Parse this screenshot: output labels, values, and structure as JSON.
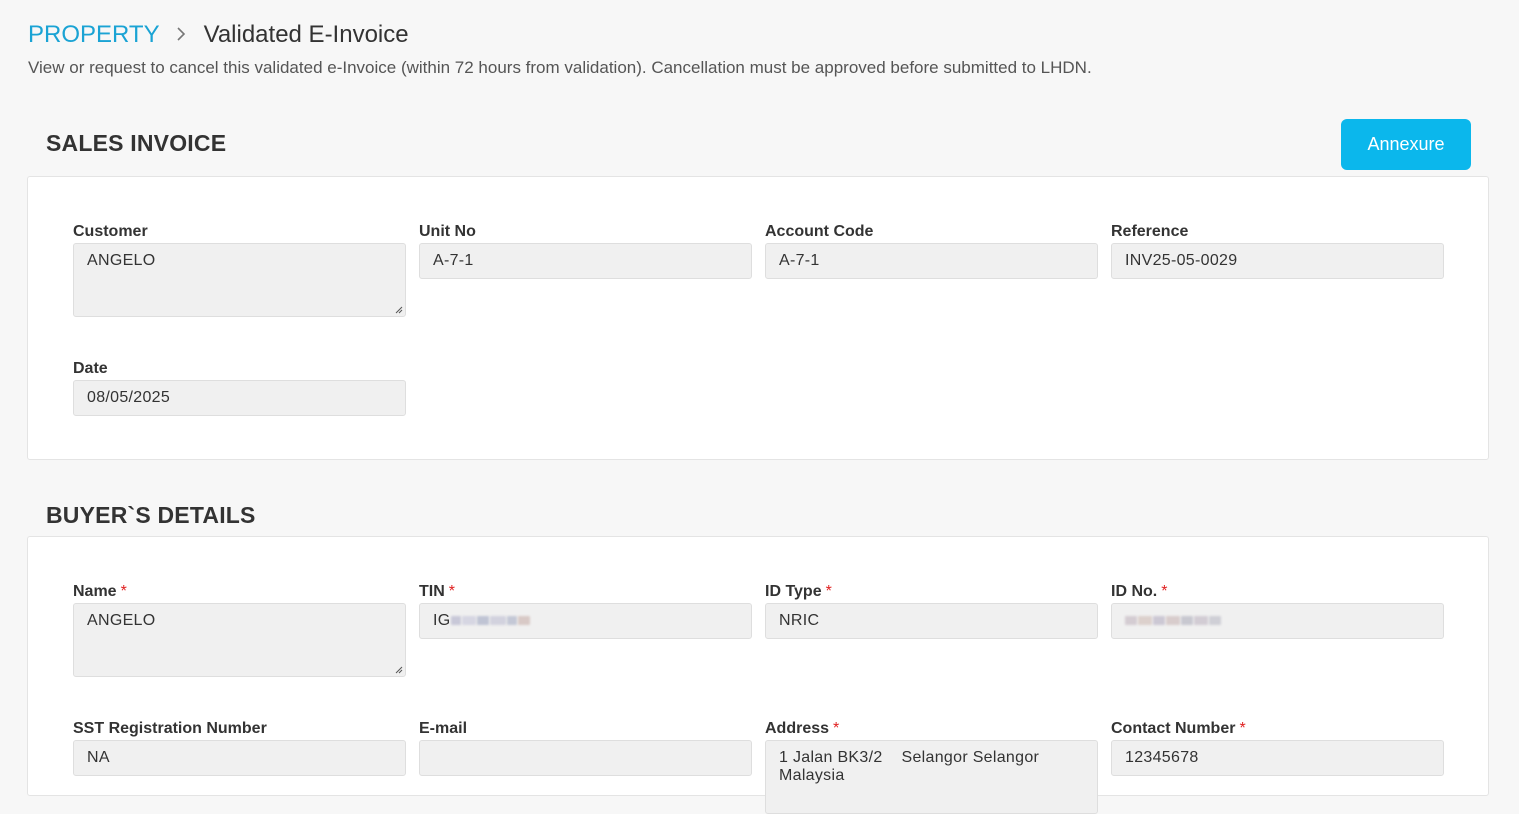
{
  "breadcrumb": {
    "parent": "PROPERTY",
    "current": "Validated E-Invoice"
  },
  "subtitle": "View or request to cancel this validated e-Invoice (within 72 hours from validation). Cancellation must be approved before submitted to LHDN.",
  "sales_invoice": {
    "title": "SALES INVOICE",
    "annexure_label": "Annexure",
    "fields": {
      "customer": {
        "label": "Customer",
        "value": "ANGELO"
      },
      "unit_no": {
        "label": "Unit No",
        "value": "A-7-1"
      },
      "account_code": {
        "label": "Account Code",
        "value": "A-7-1"
      },
      "reference": {
        "label": "Reference",
        "value": "INV25-05-0029"
      },
      "date": {
        "label": "Date",
        "value": "08/05/2025"
      }
    }
  },
  "buyer_details": {
    "title": "BUYER`S DETAILS",
    "required_marker": "*",
    "fields": {
      "name": {
        "label": "Name",
        "value": "ANGELO"
      },
      "tin": {
        "label": "TIN",
        "value_prefix": "IG"
      },
      "id_type": {
        "label": "ID Type",
        "value": "NRIC"
      },
      "id_no": {
        "label": "ID No."
      },
      "sst": {
        "label": "SST Registration Number",
        "value": "NA"
      },
      "email": {
        "label": "E-mail",
        "value": ""
      },
      "address": {
        "label": "Address",
        "value": "1 Jalan BK3/2    Selangor Selangor Malaysia"
      },
      "contact": {
        "label": "Contact Number",
        "value": "12345678"
      }
    }
  },
  "colors": {
    "accent": "#1aa3d4",
    "button": "#0bb7ec",
    "required": "#e02020"
  }
}
